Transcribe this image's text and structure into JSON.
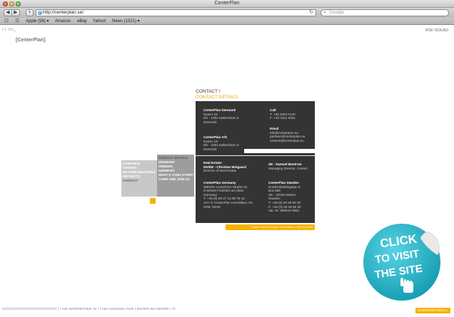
{
  "window": {
    "title": "CenterPlan"
  },
  "toolbar": {
    "back": "◀",
    "forward": "▶",
    "add": "+",
    "url": "http://centerplan.se/",
    "reload": "↻",
    "search_placeholder": "Google"
  },
  "bookmarks": [
    "Apple (56) ▾",
    "Amazon",
    "eBay",
    "Yahoo!",
    "News (1521) ▾"
  ],
  "page": {
    "top_slashes": "/ / ////_",
    "pdf_sound": "/PDF  /SOUND",
    "logo": "[CenterPlan]",
    "crumb": {
      "main": "CONTACT /",
      "sub": "CONTACT DETAILS"
    },
    "menu_primary": [
      "OVERVIEW",
      "STORIES",
      "BEYOND BUILDINGS",
      "PROJECTS",
      "CONTACT"
    ],
    "menu_secondary": [
      "CONTACT DETAILS",
      "DENMARK",
      "SWEDEN",
      "GERMANY",
      "WHAT'S YOUR STORY?",
      "COME AND JOIN US"
    ],
    "contacts": {
      "denmark": {
        "name": "CenterPlan Denmark",
        "lines": [
          "Nytorv 19",
          "DK - 1051 København K",
          "Denmark"
        ]
      },
      "as": {
        "name": "CenterPlan A/S",
        "lines": [
          "Nytorv 19",
          "DK - 1051 København K",
          "Denmark"
        ]
      },
      "call": {
        "title": "Call",
        "lines": [
          "T: +45 3333 0130",
          "F: +45 3311 9301"
        ]
      },
      "email": {
        "title": "Email",
        "lines": [
          "info@centerplan.eu",
          "partners@centerplan.eu",
          "careers@centerplan.eu"
        ]
      },
      "realestate": {
        "title1": "Real Estate:",
        "title2": "DK/DE - Christian Molgaard",
        "lines": [
          "Director of Real Estate"
        ]
      },
      "se_person": {
        "title": "SE - Samuel Bostrom",
        "lines": [
          "Managing Director, Centerl"
        ]
      },
      "germany": {
        "name": "CenterPlan Germany",
        "lines": [
          "Wilhelm-Leuschner-Straße 10",
          "D-60329 Frankfurt am Main",
          "Germany",
          "T: +49 (0) 69 27 13 99 79 12",
          "VAT nr CenterPlan Immobilien AG",
          "HRB 79446"
        ]
      },
      "sweden": {
        "name": "CenterPlan Sweden",
        "lines": [
          "Nordenskiöldsgatan 8",
          "Box 588",
          "SE - 20025 Malmö",
          "Sweden",
          "T: +46 (0) 40 39 65 30",
          "F: +46 (0) 40 39 65 32",
          "Vat. Nr: 556610-6661"
        ]
      }
    },
    "credits": "Jaquie Nouvi Design Consultancy / Site by unitS",
    "sticker": {
      "line1": "CLICK",
      "line2": "TO VISIT",
      "line3": "THE SITE"
    },
    "footer": "//////////////////////////////////////////////////  |  I AM INTERESTED IN  /  I AM LOOKING FOR  |  ENTER KEYWORD  |  ///",
    "read_button": "SUGGESTED READ ▸"
  },
  "colors": {
    "accent": "#f5b200",
    "panel": "#343434",
    "sticker": "#1fb3c9"
  }
}
